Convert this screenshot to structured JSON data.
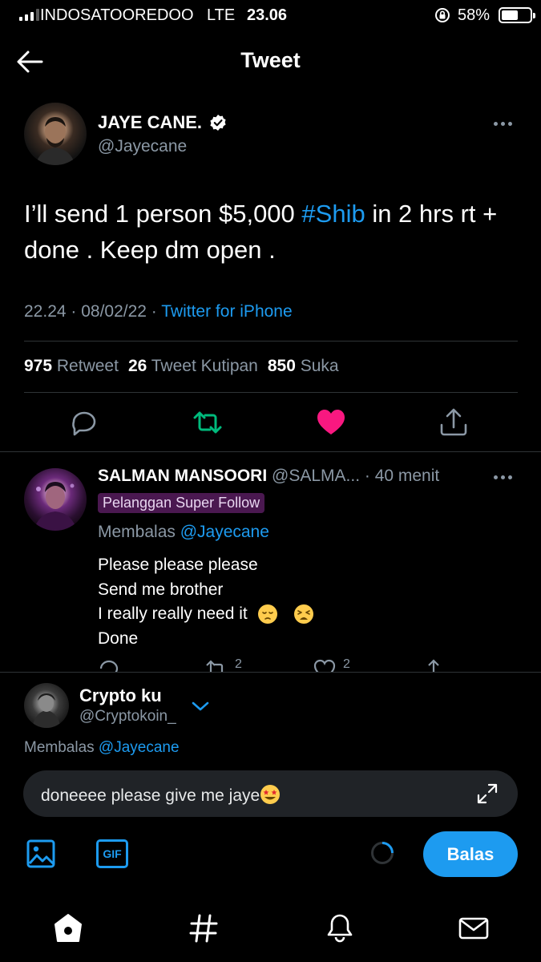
{
  "status_bar": {
    "carrier": "INDOSATOOREDOO",
    "network": "LTE",
    "time": "23.06",
    "battery": "58%",
    "battery_level": 0.58
  },
  "header": {
    "title": "Tweet",
    "back_icon": "arrow-left-icon"
  },
  "tweet": {
    "author_name": "JAYE CANE.",
    "author_handle": "@Jayecane",
    "verified": true,
    "text_before": "I’ll send 1 person $5,000 ",
    "hashtag": "#Shib",
    "text_after": " in 2 hrs rt + done . Keep dm open .",
    "time": "22.24 · 08/02/22 · ",
    "source": "Twitter for iPhone",
    "stats": {
      "retweets": "975",
      "retweets_label": "Retweet",
      "quotes": "26",
      "quotes_label": "Tweet Kutipan",
      "likes": "850",
      "likes_label": "Suka"
    },
    "colors": {
      "retweet": "#00ba7c",
      "like": "#f91880",
      "link": "#1d9bf0"
    }
  },
  "reply": {
    "author_name": "SALMAN MANSOORI",
    "author_handle": "@SALMA...",
    "time": " · 40 menit",
    "badge": "Pelanggan Super Follow",
    "replying_label": "Membalas ",
    "replying_to": "@Jayecane",
    "lines": [
      "Please please please",
      "Send me brother",
      "I really really need it",
      "Done"
    ],
    "emojis": [
      "pensive-face-icon",
      "weary-face-icon"
    ],
    "retweets": "2",
    "likes": "2"
  },
  "compose": {
    "user_name": "Crypto ku",
    "user_handle": "@Cryptokoin_",
    "replying_label": "Membalas ",
    "replying_to": "@Jayecane",
    "input_value": "doneeee please give me jaye",
    "input_emoji": "star-struck-face-icon",
    "send_label": "Balas",
    "gif_label": "GIF"
  },
  "tabbar": {
    "items": [
      "home-icon",
      "explore-hashtag-icon",
      "notifications-bell-icon",
      "messages-envelope-icon"
    ]
  }
}
